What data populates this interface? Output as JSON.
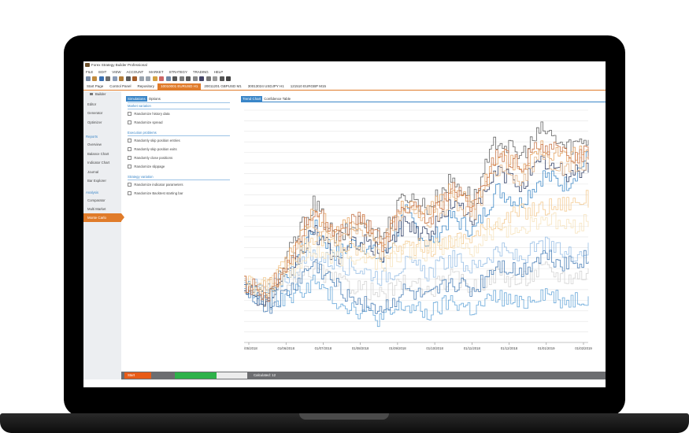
{
  "window": {
    "title": "Forex Strategy Builder Professional"
  },
  "menu": [
    "FILE",
    "EDIT",
    "VIEW",
    "ACCOUNT",
    "MARKET",
    "STRATEGY",
    "TRADING",
    "HELP"
  ],
  "doc_tabs": [
    {
      "label": "Start Page",
      "active": false
    },
    {
      "label": "Control Panel",
      "active": false
    },
    {
      "label": "Repository",
      "active": false
    },
    {
      "label": "10010001 EURUSD H1",
      "active": true
    },
    {
      "label": "20011201 GBPUSD M1",
      "active": false
    },
    {
      "label": "30013024 USDJPY H1",
      "active": false
    },
    {
      "label": "121510 EURGBP M15",
      "active": false
    }
  ],
  "sidebar": {
    "builder_label": "Builder",
    "items_top": [
      "Editor",
      "Generator",
      "Optimizer"
    ],
    "reports_title": "Reports",
    "reports_items": [
      "Overview",
      "Balance Chart",
      "Indicator Chart",
      "Journal",
      "Bar Explorer"
    ],
    "analysis_title": "Analysis",
    "analysis_items": [
      "Comparator",
      "Multi Market",
      "Monte Carlo"
    ],
    "active_item": "Monte Carlo"
  },
  "options": {
    "tabs": [
      "Simulations",
      "Options"
    ],
    "sections": [
      {
        "title": "Market variation",
        "items": [
          "Randomize history data",
          "Randomize spread"
        ]
      },
      {
        "title": "Execution problems",
        "items": [
          "Randomly skip position entries",
          "Randomly skip position exits",
          "Randomly close positions",
          "Randomize slippage"
        ]
      },
      {
        "title": "Strategy variation",
        "items": [
          "Randomize indicator parameters",
          "Randomize Backtest starting bar"
        ]
      }
    ]
  },
  "chart_tabs": [
    "Trend Chart",
    "Confidence Table"
  ],
  "chart_data": {
    "type": "line",
    "x": [
      "01/05/2018",
      "01/06/2018",
      "01/07/2018",
      "01/08/2018",
      "01/09/2018",
      "01/10/2018",
      "01/11/2018",
      "01/12/2018",
      "01/01/2019",
      "01/02/2019"
    ],
    "series": [
      {
        "color": "#2f7fc2",
        "values": [
          45,
          40,
          52,
          70,
          58,
          64,
          55,
          76,
          62,
          74,
          68,
          86,
          80,
          92,
          88,
          100
        ]
      },
      {
        "color": "#555555",
        "values": [
          45,
          38,
          60,
          80,
          64,
          72,
          66,
          84,
          78,
          90,
          82,
          108,
          100,
          112,
          104,
          108
        ]
      },
      {
        "color": "#e39a52",
        "values": [
          45,
          42,
          58,
          76,
          68,
          72,
          64,
          80,
          76,
          86,
          80,
          100,
          96,
          104,
          98,
          104
        ]
      },
      {
        "color": "#1f2f5a",
        "values": [
          45,
          36,
          50,
          68,
          56,
          64,
          58,
          72,
          66,
          80,
          74,
          94,
          88,
          98,
          92,
          96
        ]
      },
      {
        "color": "#f3c78a",
        "values": [
          45,
          44,
          56,
          66,
          62,
          60,
          58,
          62,
          60,
          64,
          66,
          72,
          76,
          78,
          80,
          82
        ]
      },
      {
        "color": "#8fb9e3",
        "values": [
          45,
          42,
          50,
          58,
          54,
          52,
          48,
          54,
          50,
          56,
          52,
          60,
          56,
          62,
          58,
          60
        ]
      },
      {
        "color": "#cfcfcf",
        "values": [
          45,
          40,
          44,
          52,
          46,
          44,
          40,
          46,
          42,
          48,
          44,
          50,
          46,
          52,
          48,
          50
        ]
      },
      {
        "color": "#e3b07e",
        "values": [
          45,
          43,
          54,
          72,
          64,
          70,
          62,
          78,
          70,
          82,
          76,
          96,
          90,
          100,
          94,
          98
        ]
      },
      {
        "color": "#5aa0d6",
        "values": [
          45,
          38,
          40,
          46,
          38,
          34,
          30,
          36,
          32,
          38,
          34,
          40,
          36,
          42,
          38,
          40
        ]
      },
      {
        "color": "#3c74b0",
        "values": [
          45,
          34,
          42,
          54,
          44,
          38,
          34,
          42,
          38,
          46,
          42,
          54,
          50,
          58,
          54,
          56
        ]
      },
      {
        "color": "#f6e1b8",
        "values": [
          45,
          44,
          50,
          60,
          56,
          58,
          54,
          60,
          58,
          64,
          60,
          70,
          68,
          74,
          70,
          72
        ]
      },
      {
        "color": "#c46a3a",
        "values": [
          45,
          41,
          57,
          78,
          66,
          74,
          62,
          80,
          72,
          86,
          78,
          102,
          96,
          106,
          100,
          102
        ]
      }
    ],
    "ylim": [
      20,
      120
    ],
    "grid": true
  },
  "status": {
    "start_label": "Start",
    "progress": 0.58,
    "calculated_label": "Calculated: 12"
  },
  "colors": {
    "accent": "#e07b2a",
    "blue": "#3a86c8",
    "progress": "#2eb24a"
  }
}
